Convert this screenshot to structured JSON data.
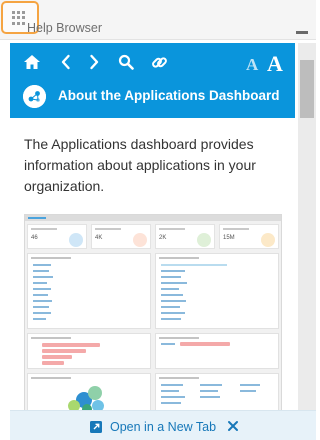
{
  "header": {
    "title": "Help Browser",
    "grip_icon": "drag-grip-icon",
    "minimize_icon": "minimize-icon"
  },
  "toolbar": {
    "icons": [
      "home-icon",
      "back-icon",
      "forward-icon",
      "search-icon",
      "link-icon"
    ],
    "font_decrease_label": "A",
    "font_increase_label": "A",
    "background_color": "#0a95dc"
  },
  "topic": {
    "icon": "dashboard-icon",
    "title": "About the Applications Dashboard"
  },
  "content": {
    "intro": "The Applications dashboard provides information about applications in your organization.",
    "screenshot": {
      "kpis": [
        {
          "value": "46"
        },
        {
          "value": "4K"
        },
        {
          "value": "2K"
        },
        {
          "value": "15M"
        }
      ]
    }
  },
  "footer": {
    "open_new_tab_label": "Open in a New Tab",
    "close_icon": "close-icon",
    "background_color": "#e7f2f9"
  }
}
